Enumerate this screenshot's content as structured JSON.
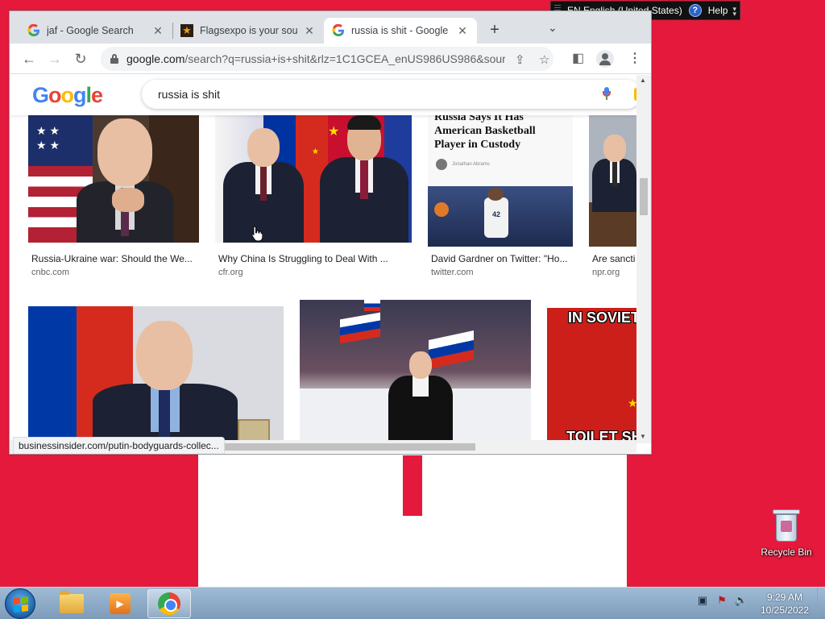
{
  "langbar": {
    "lang": "EN English (United States)",
    "help": "Help"
  },
  "tabs": [
    {
      "title": "jaf - Google Search",
      "favicon": "google-icon"
    },
    {
      "title": "Flagsexpo is your sourc",
      "favicon": "star-icon"
    },
    {
      "title": "russia is shit - Google S",
      "favicon": "google-icon",
      "active": true
    }
  ],
  "omnibox": {
    "host": "google.com",
    "rest": "/search?q=russia+is+shit&rlz=1C1GCEA_enUS986US986&sour..."
  },
  "search": {
    "logo": "Google",
    "query": "russia is shit"
  },
  "row1": [
    {
      "caption": "Russia-Ukraine war: Should the We...",
      "source": "cnbc.com"
    },
    {
      "caption": "Why China Is Struggling to Deal With ...",
      "source": "cfr.org"
    },
    {
      "caption": "David Gardner on Twitter: \"Ho...",
      "source": "twitter.com",
      "headline": "Russia Says It Has American Basketball Player in Custody",
      "byline": "Jonathan Abrams",
      "jersey": "42"
    },
    {
      "caption": "Are sancti",
      "source": "npr.org"
    }
  ],
  "row2": [
    {
      "caption": "",
      "source": ""
    },
    {
      "caption": "",
      "source": ""
    },
    {
      "top_text": "IN SOVIET",
      "bottom_text": "TOILET SH"
    }
  ],
  "status_url": "businessinsider.com/putin-bodyguards-collec...",
  "desktop": {
    "recycle_bin": "Recycle Bin"
  },
  "clock": {
    "time": "9:29 AM",
    "date": "10/25/2022"
  },
  "colors": {
    "wallpaper_red": "#e4193b",
    "google_blue": "#4285f4",
    "google_red": "#ea4335",
    "google_yellow": "#fbbc05",
    "google_green": "#34a853"
  }
}
